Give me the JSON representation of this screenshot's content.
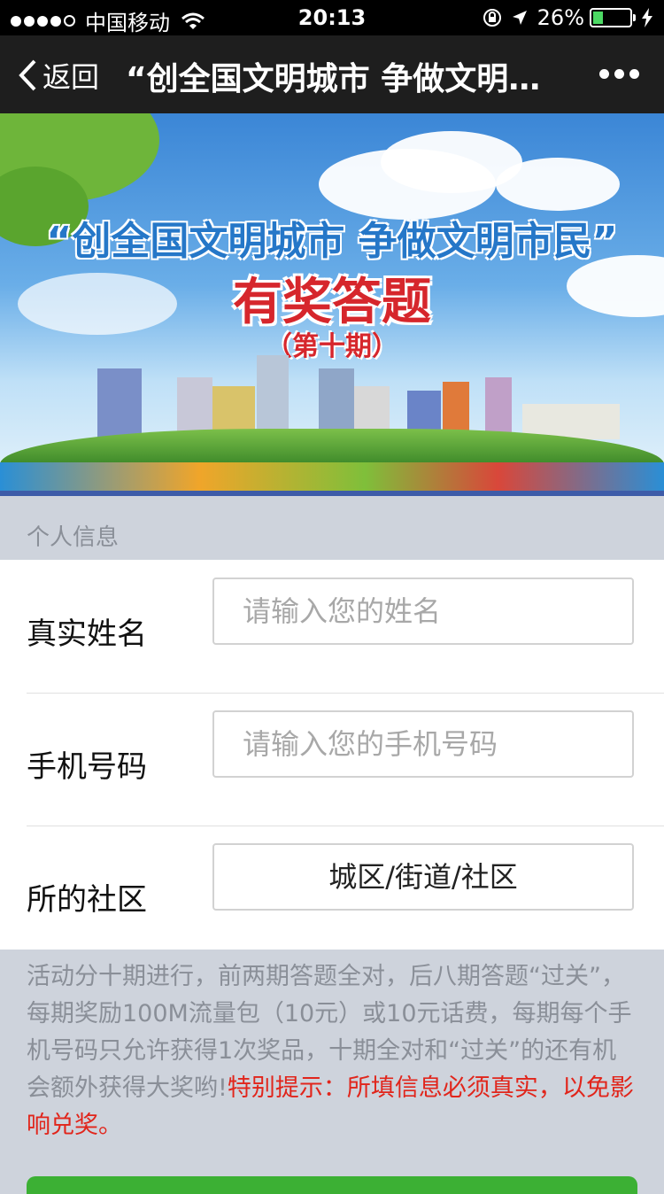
{
  "status_bar": {
    "carrier": "中国移动",
    "time": "20:13",
    "battery": "26%",
    "battery_level": 0.26
  },
  "nav": {
    "back_label": "返回",
    "title": "“创全国文明城市 争做文明市民”有奖答题"
  },
  "banner": {
    "title": "“创全国文明城市  争做文明市民”",
    "subtitle": "有奖答题",
    "issue": "（第十期）"
  },
  "section": {
    "label": "个人信息"
  },
  "form": {
    "fields": [
      {
        "label": "真实姓名",
        "placeholder": "请输入您的姓名"
      },
      {
        "label": "手机号码",
        "placeholder": "请输入您的手机号码"
      },
      {
        "label": "所的社区",
        "value": "城区/街道/社区"
      }
    ]
  },
  "notice": {
    "text": "活动分十期进行，前两期答题全对，后八期答题“过关”，每期奖励100M流量包（10元）或10元话费，每期每个手机号码只允许获得1次奖品，十期全对和“过关”的还有机会额外获得大奖哟!",
    "warning": "特别提示：所填信息必须真实，以免影响兑奖。"
  },
  "colors": {
    "nav_bg": "#1e1e1e",
    "warning": "#e1251b",
    "button": "#3cb034"
  }
}
